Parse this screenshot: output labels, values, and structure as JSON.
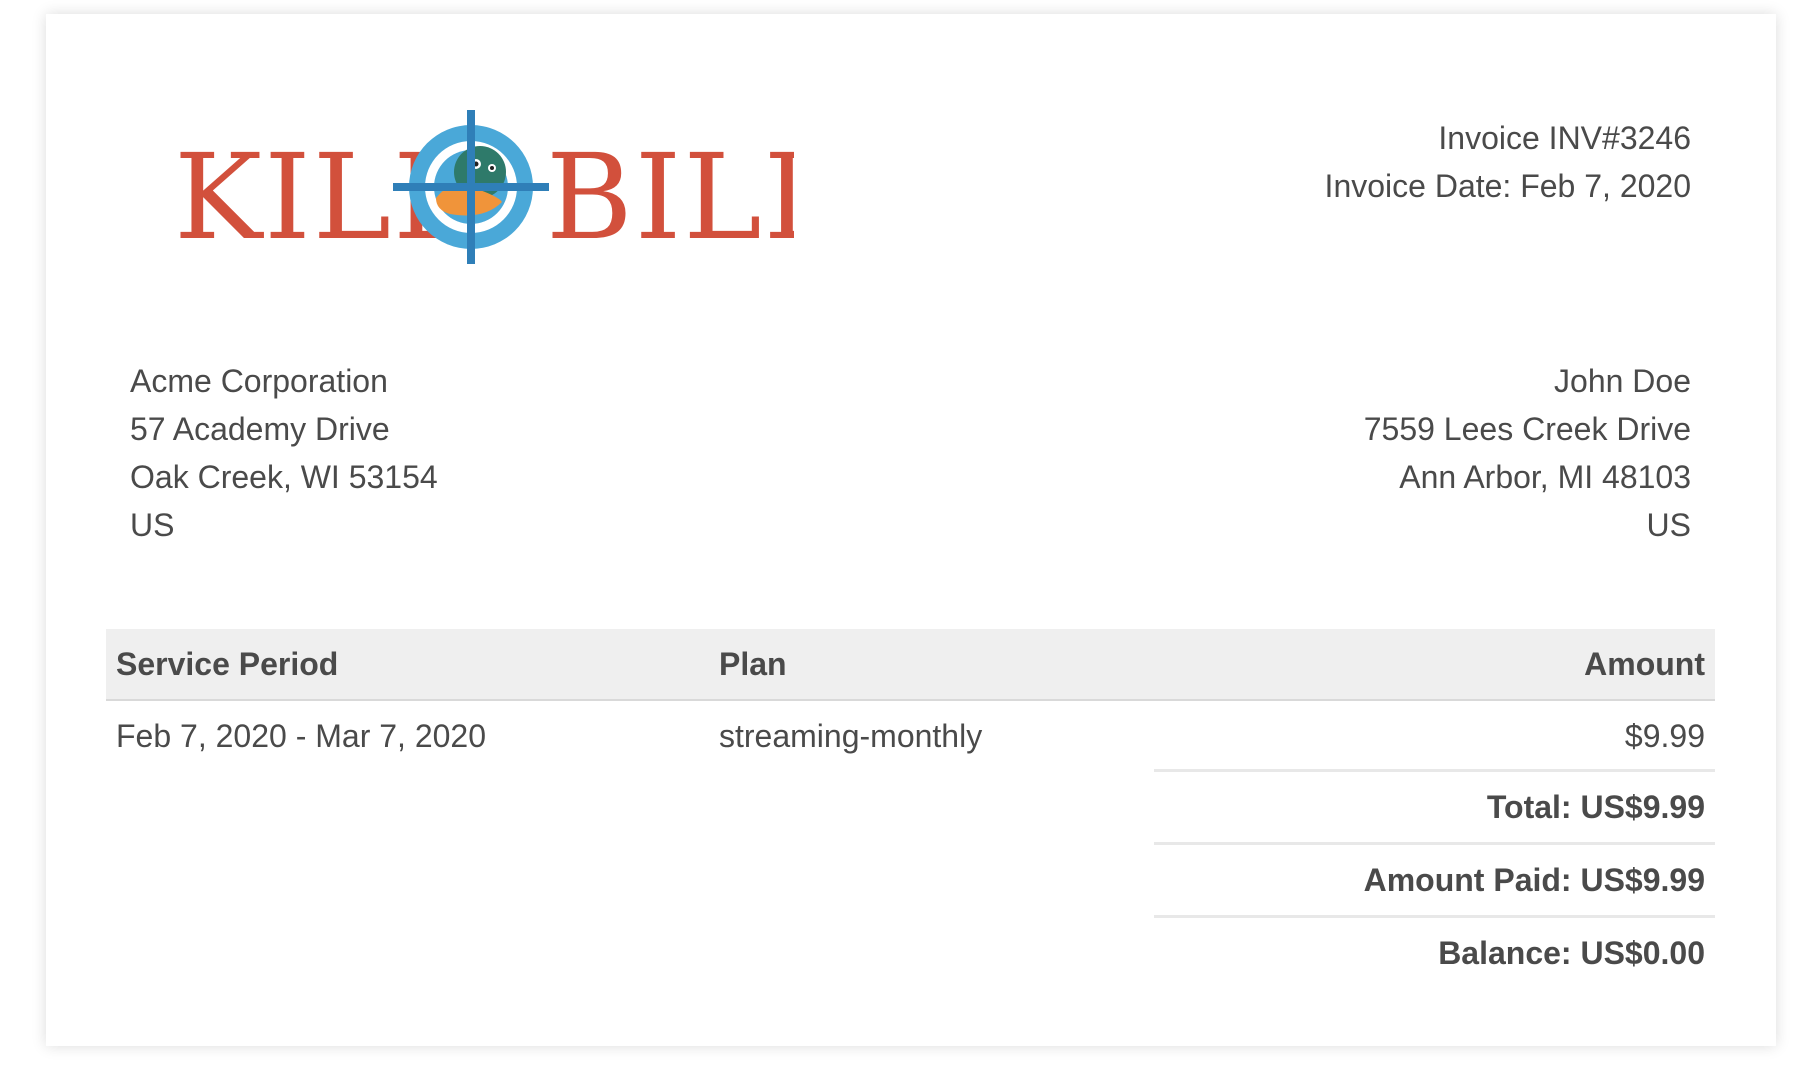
{
  "logo": {
    "text_left": "KILL",
    "text_right": "BILL",
    "icon": "duck-crosshair-icon"
  },
  "invoice": {
    "number_line": "Invoice INV#3246",
    "date_line": "Invoice Date: Feb 7, 2020"
  },
  "from": [
    "Acme Corporation",
    "57 Academy Drive",
    "Oak Creek, WI 53154",
    "US"
  ],
  "to": [
    "John Doe",
    "7559 Lees Creek Drive",
    "Ann Arbor, MI 48103",
    "US"
  ],
  "table": {
    "headers": {
      "period": "Service Period",
      "plan": "Plan",
      "amount": "Amount"
    },
    "rows": [
      {
        "period": "Feb 7, 2020 - Mar 7, 2020",
        "plan": "streaming-monthly",
        "amount": "$9.99"
      }
    ]
  },
  "totals": {
    "total": "Total: US$9.99",
    "paid": "Amount Paid: US$9.99",
    "balance": "Balance: US$0.00"
  },
  "colors": {
    "logo_red": "#d2503c",
    "target_blue": "#4aa8d8",
    "crosshair_blue": "#2f7fb8",
    "duck_orange": "#f0943a"
  }
}
